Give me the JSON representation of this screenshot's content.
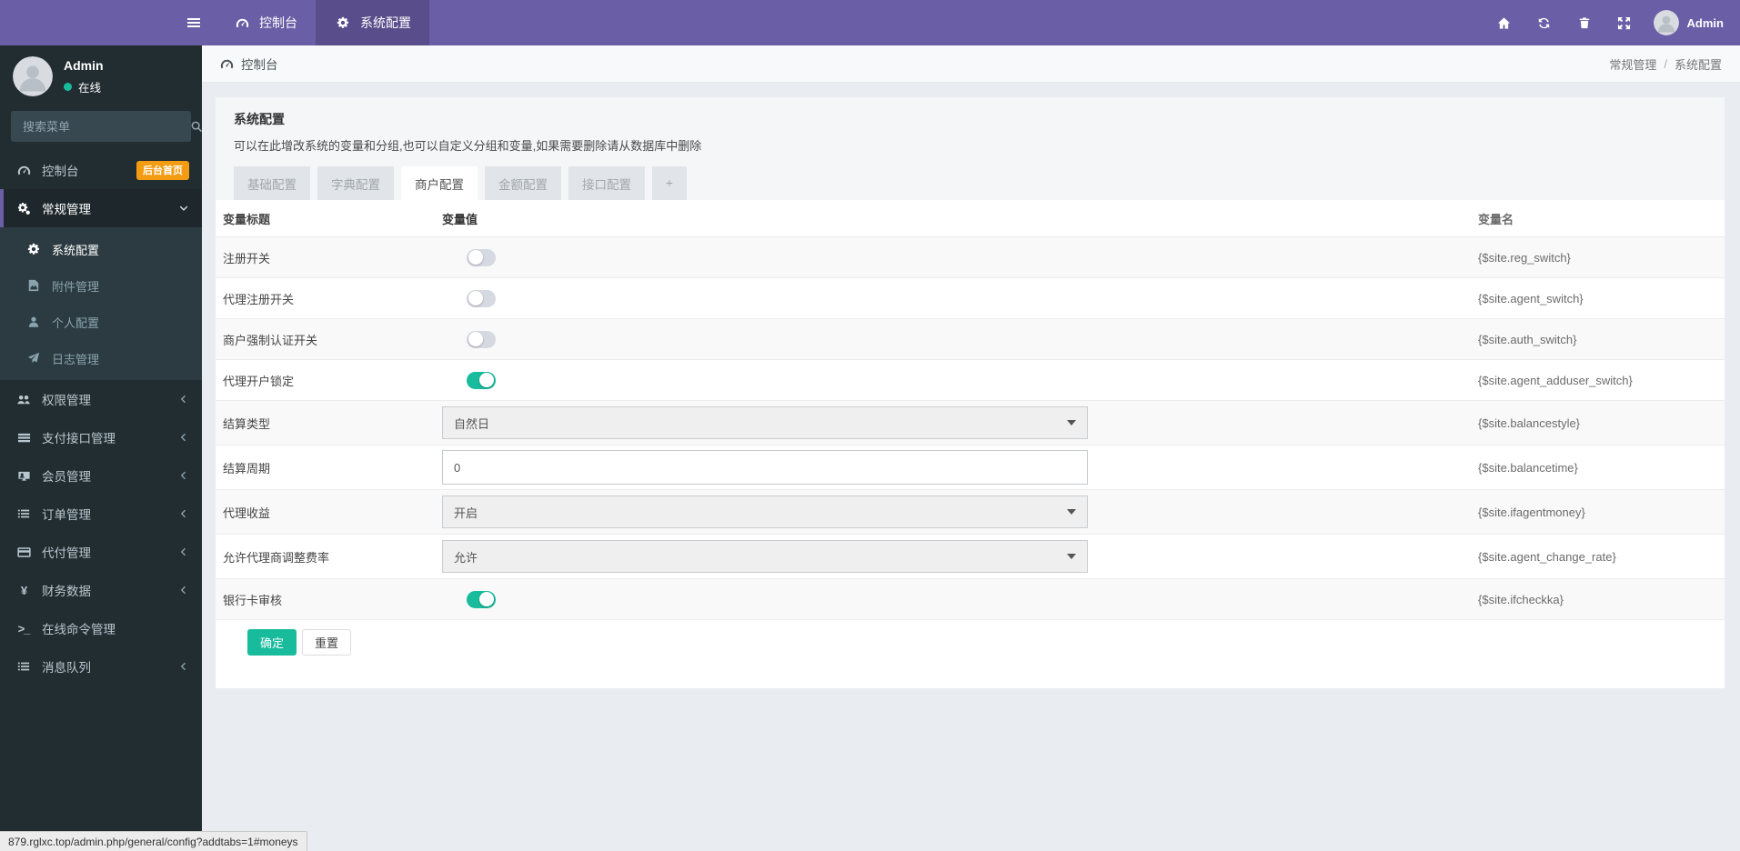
{
  "colors": {
    "navbar_purple": "#6a5ea6",
    "accent_green": "#18bc9c",
    "badge_orange": "#f39c12",
    "sidebar_dark": "#222d32"
  },
  "navbar": {
    "tabs": [
      {
        "label": "控制台",
        "icon": "tachometer",
        "active": false
      },
      {
        "label": "系统配置",
        "icon": "gear",
        "active": true
      }
    ],
    "icons": [
      "home",
      "refresh",
      "trash",
      "expand"
    ],
    "user_label": "Admin"
  },
  "sidebar": {
    "user": {
      "name": "Admin",
      "status": "在线"
    },
    "search_placeholder": "搜索菜单",
    "items": [
      {
        "icon": "tachometer",
        "label": "控制台",
        "badge": "后台首页"
      },
      {
        "icon": "gears",
        "label": "常规管理",
        "active": true,
        "chevron": "down",
        "children": [
          {
            "icon": "gear",
            "label": "系统配置",
            "active": true
          },
          {
            "icon": "file-image",
            "label": "附件管理"
          },
          {
            "icon": "user",
            "label": "个人配置"
          },
          {
            "icon": "paper-plane",
            "label": "日志管理"
          }
        ]
      },
      {
        "icon": "users",
        "label": "权限管理",
        "chevron": "left"
      },
      {
        "icon": "bars",
        "label": "支付接口管理",
        "chevron": "left"
      },
      {
        "icon": "member",
        "label": "会员管理",
        "chevron": "left"
      },
      {
        "icon": "list",
        "label": "订单管理",
        "chevron": "left"
      },
      {
        "icon": "credit-card",
        "label": "代付管理",
        "chevron": "left"
      },
      {
        "icon": "yen",
        "label": "财务数据",
        "chevron": "left"
      },
      {
        "icon": "terminal",
        "label": "在线命令管理"
      },
      {
        "icon": "list",
        "label": "消息队列",
        "chevron": "left"
      }
    ]
  },
  "breadcrumb": {
    "left_label": "控制台",
    "path": [
      "常规管理",
      "系统配置"
    ],
    "separator": "/"
  },
  "panel": {
    "title": "系统配置",
    "description": "可以在此增改系统的变量和分组,也可以自定义分组和变量,如果需要删除请从数据库中删除",
    "tabs": [
      {
        "label": "基础配置"
      },
      {
        "label": "字典配置"
      },
      {
        "label": "商户配置",
        "active": true
      },
      {
        "label": "金额配置"
      },
      {
        "label": "接口配置"
      },
      {
        "label": "+",
        "is_add": true
      }
    ]
  },
  "table": {
    "headers": [
      "变量标题",
      "变量值",
      "变量名"
    ],
    "rows": [
      {
        "title": "注册开关",
        "type": "switch",
        "on": false,
        "name": "{$site.reg_switch}"
      },
      {
        "title": "代理注册开关",
        "type": "switch",
        "on": false,
        "name": "{$site.agent_switch}"
      },
      {
        "title": "商户强制认证开关",
        "type": "switch",
        "on": false,
        "name": "{$site.auth_switch}"
      },
      {
        "title": "代理开户锁定",
        "type": "switch",
        "on": true,
        "name": "{$site.agent_adduser_switch}"
      },
      {
        "title": "结算类型",
        "type": "select",
        "value": "自然日",
        "name": "{$site.balancestyle}"
      },
      {
        "title": "结算周期",
        "type": "input",
        "value": "0",
        "name": "{$site.balancetime}"
      },
      {
        "title": "代理收益",
        "type": "select",
        "value": "开启",
        "name": "{$site.ifagentmoney}"
      },
      {
        "title": "允许代理商调整费率",
        "type": "select",
        "value": "允许",
        "name": "{$site.agent_change_rate}"
      },
      {
        "title": "银行卡审核",
        "type": "switch",
        "on": true,
        "name": "{$site.ifcheckka}"
      }
    ],
    "buttons": {
      "submit": "确定",
      "reset": "重置"
    }
  },
  "statusbar": {
    "url": "879.rglxc.top/admin.php/general/config?addtabs=1#moneys"
  }
}
